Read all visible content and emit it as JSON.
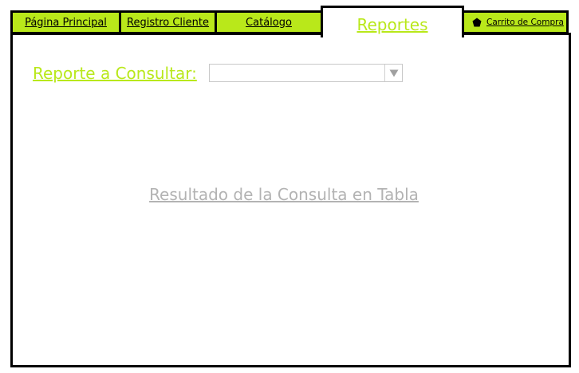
{
  "nav": {
    "tabs": [
      {
        "label": "Página Principal"
      },
      {
        "label": "Registro Cliente"
      },
      {
        "label": "Catálogo"
      },
      {
        "label": "Reportes",
        "active": true
      }
    ],
    "cart": {
      "label": "Carrito de Compra",
      "icon": "cart-icon"
    }
  },
  "report": {
    "label": "Reporte a Consultar:",
    "selected": ""
  },
  "result": {
    "placeholder": "Resultado de la Consulta en Tabla"
  },
  "colors": {
    "accent": "#b9e81a",
    "border": "#000000",
    "placeholder_text": "#b3b3b3"
  }
}
